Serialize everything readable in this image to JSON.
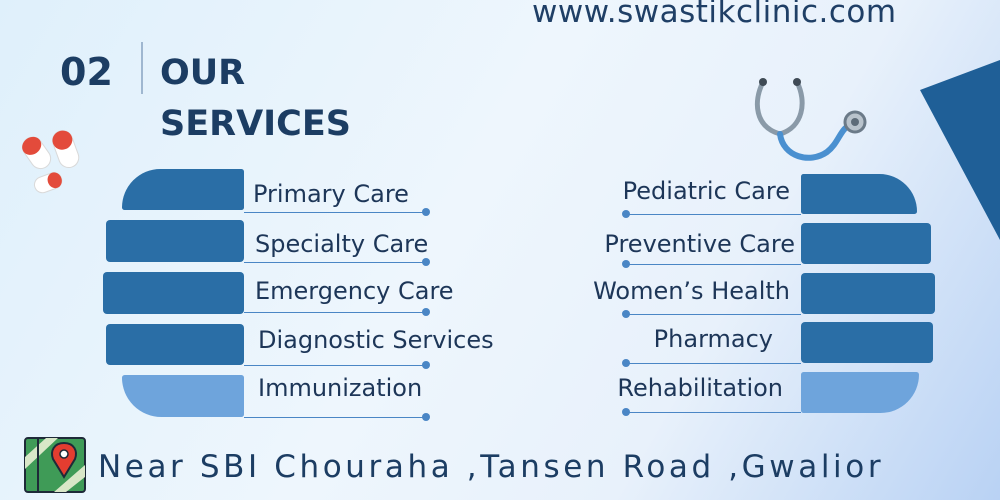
{
  "website": "www.swastikclinic.com",
  "section": {
    "number": "02",
    "title_line1": "OUR",
    "title_line2": "SERVICES"
  },
  "services_left": [
    {
      "label": "Primary Care"
    },
    {
      "label": "Specialty Care"
    },
    {
      "label": "Emergency Care"
    },
    {
      "label": "Diagnostic Services"
    },
    {
      "label": "Immunization"
    }
  ],
  "services_right": [
    {
      "label": "Pediatric Care"
    },
    {
      "label": "Preventive Care"
    },
    {
      "label": "Women’s Health"
    },
    {
      "label": "Pharmacy"
    },
    {
      "label": "Rehabilitation"
    }
  ],
  "address": "Near SBI Chouraha ,Tansen Road ,Gwalior",
  "colors": {
    "dark_blue": "#1c3d63",
    "band_blue": "#2a6ea6",
    "band_light": "#6ea4dc",
    "accent_line": "#4a86c5"
  },
  "icons": [
    "stethoscope-icon",
    "pills-icon",
    "map-pin-icon"
  ]
}
